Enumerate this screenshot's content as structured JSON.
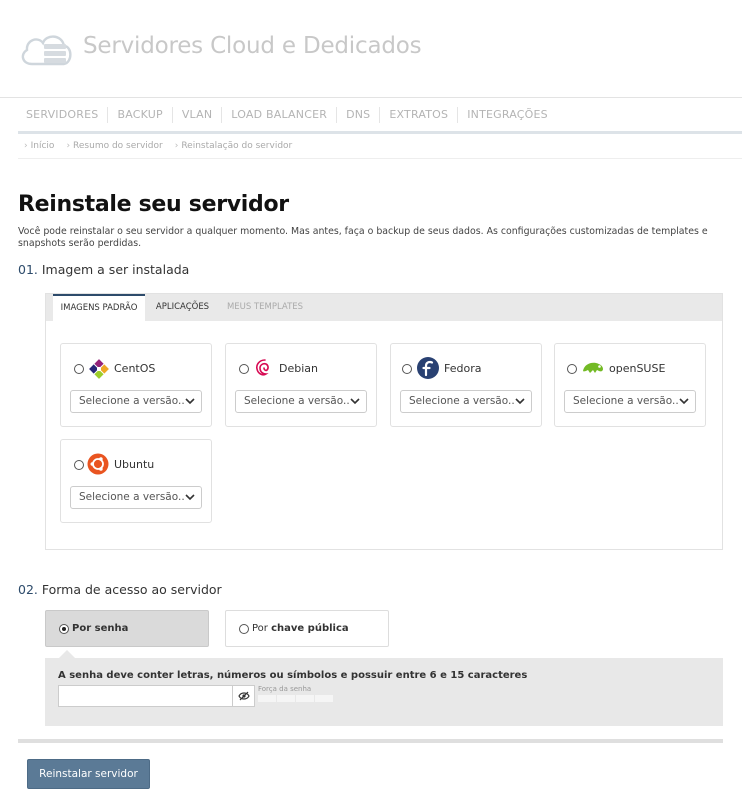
{
  "header": {
    "brand": "Servidores Cloud e Dedicados",
    "logo_icon": "cloud-server-icon"
  },
  "nav": {
    "items": [
      "SERVIDORES",
      "BACKUP",
      "VLAN",
      "LOAD BALANCER",
      "DNS",
      "EXTRATOS",
      "INTEGRAÇÕES"
    ]
  },
  "breadcrumb": [
    "Início",
    "Resumo do servidor",
    "Reinstalação do servidor"
  ],
  "page": {
    "title": "Reinstale seu servidor",
    "intro": "Você pode reinstalar o seu servidor a qualquer momento. Mas antes, faça o backup de seus dados. As configurações customizadas de templates e snapshots serão perdidas."
  },
  "section1": {
    "num": "01.",
    "title": "Imagem a ser instalada"
  },
  "tabs": [
    "IMAGENS PADRÃO",
    "APLICAÇÕES",
    "MEUS TEMPLATES"
  ],
  "images": [
    {
      "name": "CentOS",
      "select": "Selecione a versão..",
      "icon": "centos-logo-icon"
    },
    {
      "name": "Debian",
      "select": "Selecione a versão..",
      "icon": "debian-logo-icon"
    },
    {
      "name": "Fedora",
      "select": "Selecione a versão..",
      "icon": "fedora-logo-icon"
    },
    {
      "name": "openSUSE",
      "select": "Selecione a versão..",
      "icon": "opensuse-logo-icon"
    },
    {
      "name": "Ubuntu",
      "select": "Selecione a versão..",
      "icon": "ubuntu-logo-icon"
    }
  ],
  "section2": {
    "num": "02.",
    "title": "Forma de acesso ao servidor"
  },
  "access": {
    "option1": "Por senha",
    "option2_prefix": "Por ",
    "option2_bold": "chave pública"
  },
  "password": {
    "label": "A senha deve conter letras, números ou símbolos e possuir entre 6 e 15 caracteres",
    "value": "",
    "strength_label": "Força da senha",
    "eye_icon": "eye-toggle-icon"
  },
  "actions": {
    "submit": "Reinstalar servidor"
  },
  "colors": {
    "accent": "#2d4b6b",
    "button": "#5b7a96",
    "centos": "#932279",
    "debian": "#d70a53",
    "fedora": "#294172",
    "opensuse": "#73ba25",
    "ubuntu": "#e95420"
  }
}
